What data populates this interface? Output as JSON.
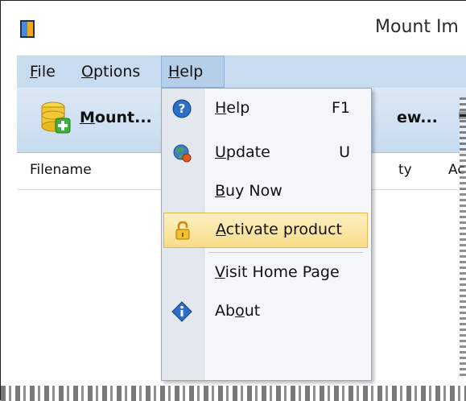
{
  "window": {
    "title": "Mount Im"
  },
  "menubar": {
    "items": [
      {
        "pre": "",
        "key": "F",
        "post": "ile"
      },
      {
        "pre": "",
        "key": "O",
        "post": "ptions"
      },
      {
        "pre": "",
        "key": "H",
        "post": "elp"
      }
    ]
  },
  "toolbar": {
    "mount": {
      "pre": "",
      "key": "M",
      "post": "ount..."
    },
    "partial": "ew...",
    "mark": "▪"
  },
  "table": {
    "columns": [
      "Filename",
      "ty",
      "Ac"
    ]
  },
  "help_menu": {
    "items": [
      {
        "icon": "help-icon",
        "pre": "",
        "key": "H",
        "post": "elp",
        "shortcut": "F1"
      },
      {
        "icon": "update-icon",
        "pre": "",
        "key": "U",
        "post": "pdate",
        "shortcut": "U"
      },
      {
        "icon": "",
        "pre": "",
        "key": "B",
        "post": "uy Now",
        "shortcut": ""
      },
      {
        "icon": "lock-icon",
        "pre": "",
        "key": "A",
        "post": "ctivate product",
        "shortcut": ""
      },
      {
        "icon": "",
        "pre": "",
        "key": "V",
        "post": "isit Home Page",
        "shortcut": ""
      },
      {
        "icon": "about-icon",
        "pre": "Ab",
        "key": "o",
        "post": "ut",
        "shortcut": ""
      }
    ]
  },
  "colors": {
    "menubar_bg": "#c9dbee",
    "hover_bg": "#f8dc87",
    "accent": "#2b6fc9"
  }
}
